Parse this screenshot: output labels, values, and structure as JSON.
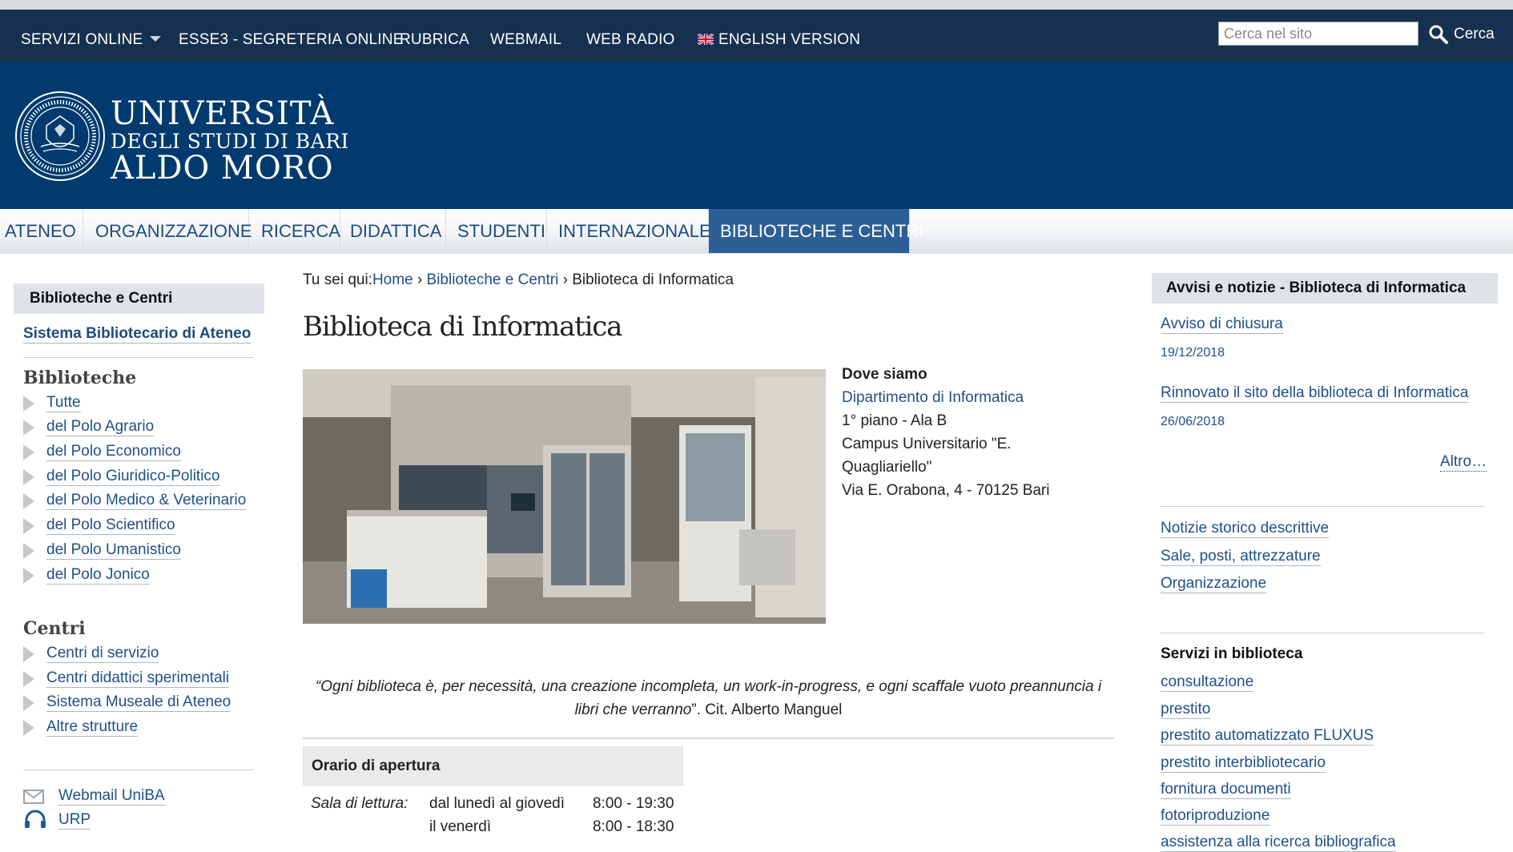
{
  "topbar": {
    "servizi_online": "SERVIZI ONLINE",
    "esse3": "ESSE3 - SEGRETERIA ONLINE",
    "rubrica": "RUBRICA",
    "webmail": "WEBMAIL",
    "web_radio": "WEB RADIO",
    "english": "ENGLISH VERSION",
    "search_placeholder": "Cerca nel sito",
    "search_button": "Cerca"
  },
  "brand": {
    "line1": "UNIVERSITÀ",
    "line2": "DEGLI STUDI DI BARI",
    "line3": "ALDO MORO"
  },
  "nav": [
    "ATENEO",
    "ORGANIZZAZIONE",
    "RICERCA",
    "DIDATTICA",
    "STUDENTI",
    "INTERNAZIONALE",
    "BIBLIOTECHE E CENTRI"
  ],
  "sidebar": {
    "header": "Biblioteche e Centri",
    "sba": "Sistema Bibliotecario di Ateneo",
    "biblioteche_title": "Biblioteche",
    "biblioteche": [
      "Tutte",
      "del Polo Agrario",
      "del Polo Economico",
      "del Polo Giuridico-Politico",
      "del Polo Medico & Veterinario",
      "del Polo Scientifico",
      "del Polo Umanistico",
      "del Polo Jonico"
    ],
    "centri_title": "Centri",
    "centri": [
      "Centri di servizio",
      "Centri didattici sperimentali",
      "Sistema Museale di Ateneo",
      "Altre strutture"
    ],
    "webmail": "Webmail UniBA",
    "urp": "URP"
  },
  "main": {
    "breadcrumb_prefix": "Tu sei qui:",
    "breadcrumb": [
      "Home",
      "Biblioteche e Centri",
      "Biblioteca di Informatica"
    ],
    "breadcrumb_sep": "›",
    "title": "Biblioteca di Informatica",
    "dove_title": "Dove siamo",
    "dove_link": "Dipartimento di Informatica",
    "dove_lines": [
      "1° piano - Ala B",
      "Campus Universitario \"E. Quagliariello\"",
      "Via E. Orabona, 4 - 70125  Bari"
    ],
    "quote_italic": "“Ogni biblioteca è, per necessità, una creazione incompleta, un work-in-progress, e ogni scaffale vuoto preannuncia i libri che verranno",
    "quote_tail": "”. Cit. Alberto Manguel",
    "orario_title": "Orario di apertura",
    "orario": {
      "label": "Sala di lettura:",
      "days": [
        "dal lunedì al giovedì",
        "il venerdì"
      ],
      "hours": [
        "8:00 - 19:30",
        "8:00 - 18:30"
      ]
    }
  },
  "right": {
    "header": "Avvisi e notizie - Biblioteca di Informatica",
    "news": [
      {
        "title": "Avviso di chiusura",
        "date": "19/12/2018"
      },
      {
        "title": "Rinnovato il sito della biblioteca di Informatica",
        "date": "26/06/2018"
      }
    ],
    "altro": "Altro…",
    "links": [
      "Notizie storico descrittive",
      "Sale, posti, attrezzature",
      "Organizzazione"
    ],
    "servizi_title": "Servizi in biblioteca",
    "servizi": [
      "consultazione",
      "prestito",
      "prestito automatizzato FLUXUS",
      "prestito interbibliotecario",
      "fornitura documenti",
      "fotoriproduzione",
      "assistenza alla ricerca bibliografica"
    ]
  }
}
